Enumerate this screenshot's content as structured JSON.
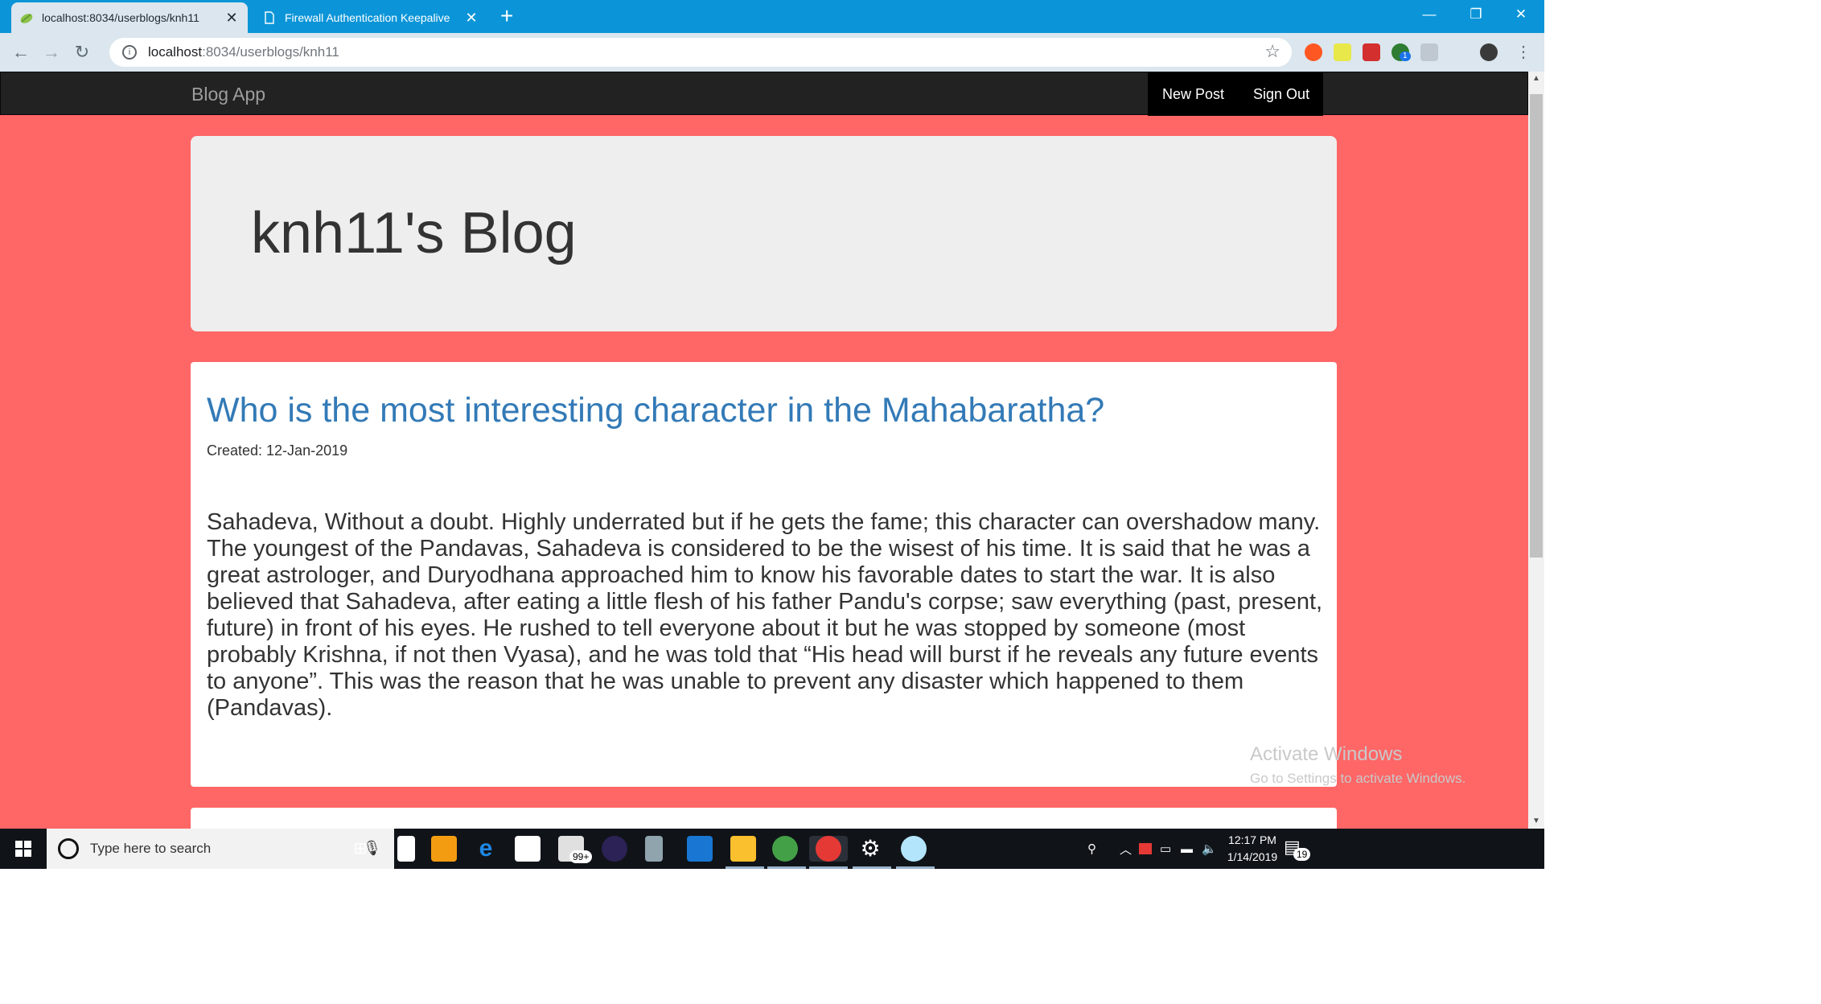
{
  "browser": {
    "tabs": [
      {
        "title": "localhost:8034/userblogs/knh11",
        "active": true
      },
      {
        "title": "Firewall Authentication Keepalive",
        "active": false
      }
    ],
    "new_tab": "+",
    "url_host": "localhost",
    "url_path": ":8034/userblogs/knh11",
    "window": {
      "minimize": "—",
      "restore": "❐",
      "close": "✕"
    },
    "extensions": [
      "puzzle-extension-icon",
      "checklist-extension-icon",
      "red-extension-icon",
      "green-extension-icon",
      "facebook-extension-icon",
      "profile-avatar-icon"
    ],
    "extension_badge": "1",
    "menu": "⋮"
  },
  "app": {
    "brand": "Blog App",
    "nav": {
      "new_post": "New Post",
      "sign_out": "Sign Out"
    },
    "jumbotron_title": "knh11's Blog",
    "posts": [
      {
        "title": "Who is the most interesting character in the Mahabaratha?",
        "created": "Created: 12-Jan-2019",
        "body": "Sahadeva, Without a doubt. Highly underrated but if he gets the fame; this character can overshadow many. The youngest of the Pandavas, Sahadeva is considered to be the wisest of his time. It is said that he was a great astrologer, and Duryodhana approached him to know his favorable dates to start the war. It is also believed that Sahadeva, after eating a little flesh of his father Pandu's corpse; saw everything (past, present, future) in front of his eyes. He rushed to tell everyone about it but he was stopped by someone (most probably Krishna, if not then Vyasa), and he was told that “His head will burst if he reveals any future events to anyone”. This was the reason that he was unable to prevent any disaster which happened to them (Pandavas)."
      }
    ]
  },
  "watermark": {
    "line1": "Activate Windows",
    "line2": "Go to Settings to activate Windows."
  },
  "taskbar": {
    "search_placeholder": "Type here to search",
    "mail_badge": "99+",
    "clock_time": "12:17 PM",
    "clock_date": "1/14/2019",
    "notification_count": "19"
  },
  "colors": {
    "page_background": "#ff6666",
    "navbar": "#222222",
    "post_title": "#337ab7",
    "chrome_tabstrip": "#0b95d8"
  }
}
